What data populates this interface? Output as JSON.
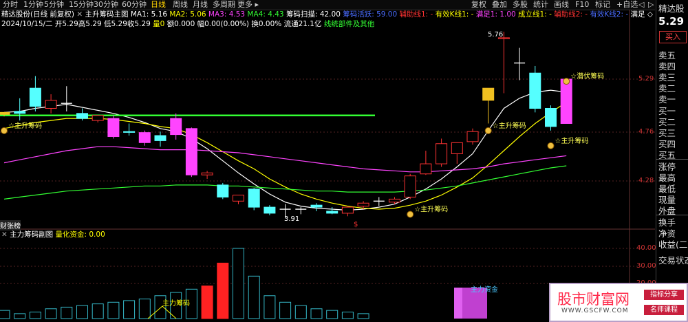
{
  "window": {
    "app_title": "精达股份(日线 前复权)"
  },
  "toolbar": {
    "left_items": [
      "分时",
      "1分钟",
      "5分钟",
      "15分钟",
      "30分钟",
      "60分钟",
      "日线",
      "周线",
      "月线",
      "多周期",
      "更多 ▸"
    ],
    "active": "日线",
    "right_items": [
      "复权",
      "叠加",
      "多股",
      "统计",
      "画线",
      "F10",
      "标记",
      "+自选",
      "◁",
      "▷"
    ]
  },
  "info_row1": {
    "app_title": "精达股份(日线 前复权)",
    "indicator_name": "主升筹码主图",
    "ma": [
      {
        "label": "MA1: 5.16",
        "color": "#ffffff"
      },
      {
        "label": "MA2: 5.06",
        "color": "#ffff00"
      },
      {
        "label": "MA3: 4.53",
        "color": "#ff44ff"
      },
      {
        "label": "MA4: 4.43",
        "color": "#33ff33"
      }
    ],
    "chip_scan": "筹码扫描: 42.00",
    "items": [
      {
        "label": "筹码活跃: 59.00",
        "color": "#4a6cff"
      },
      {
        "label": "辅助线1: -",
        "color": "#ff3333"
      },
      {
        "label": "有效K线1: -",
        "color": "#ffff00"
      },
      {
        "label": "满足1: 1.00",
        "color": "#ff44ff"
      },
      {
        "label": "成立线1: -",
        "color": "#ffff00"
      },
      {
        "label": "辅助线2: -",
        "color": "#ff3333"
      },
      {
        "label": "有效K线2: -",
        "color": "#4a6cff"
      },
      {
        "label": "满足 ◇",
        "color": "#ffffff"
      }
    ]
  },
  "info_row2": {
    "date": "2024/10/15/二",
    "open": "开5.29",
    "high": "高5.29",
    "low": "低5.29",
    "close": "收5.29",
    "volume": "量0",
    "amount": "额0.000",
    "change": "幅0.00(0.00%)",
    "turnover": "换0.00%",
    "float": "流通21.1亿",
    "extra": "线统部件及其他"
  },
  "price_axis": {
    "labels": [
      "5.29",
      "4.76",
      "4.28"
    ]
  },
  "sub_chart": {
    "title": "主力筹码副图",
    "value_label": "量化资金: 0.00",
    "axis_labels": [
      "40.00",
      "30.00",
      "20.00"
    ],
    "chip_label": "主力筹码",
    "fund_label": "主力资金"
  },
  "chart_data": {
    "type": "candlestick",
    "high_annotation": "5.76",
    "low_annotation": "3.91",
    "tag_label": "财张榜",
    "marker_labels": {
      "main_rise": "主升筹码",
      "latent": "潜伏筹码"
    },
    "candles": [
      {
        "o": 4.94,
        "h": 4.96,
        "l": 4.92,
        "c": 4.96,
        "type": "yellow"
      },
      {
        "o": 4.97,
        "h": 5.1,
        "l": 4.88,
        "c": 4.95,
        "type": "cyan"
      },
      {
        "o": 5.02,
        "h": 5.32,
        "l": 4.97,
        "c": 5.2,
        "type": "cyan"
      },
      {
        "o": 5.08,
        "h": 5.14,
        "l": 4.95,
        "c": 5.0,
        "type": "hollow"
      },
      {
        "o": 5.05,
        "h": 5.22,
        "l": 4.97,
        "c": 5.05,
        "type": "doji"
      },
      {
        "o": 4.95,
        "h": 5.0,
        "l": 4.88,
        "c": 4.9,
        "type": "cyan"
      },
      {
        "o": 4.88,
        "h": 4.93,
        "l": 4.86,
        "c": 4.93,
        "type": "hollow"
      },
      {
        "o": 4.9,
        "h": 4.93,
        "l": 4.7,
        "c": 4.72,
        "type": "magenta"
      },
      {
        "o": 4.77,
        "h": 4.85,
        "l": 4.73,
        "c": 4.77,
        "type": "cyan"
      },
      {
        "o": 4.76,
        "h": 4.78,
        "l": 4.63,
        "c": 4.66,
        "type": "magenta"
      },
      {
        "o": 4.68,
        "h": 4.77,
        "l": 4.62,
        "c": 4.73,
        "type": "cyan"
      },
      {
        "o": 4.74,
        "h": 4.95,
        "l": 4.69,
        "c": 4.9,
        "type": "magenta"
      },
      {
        "o": 4.8,
        "h": 4.81,
        "l": 4.32,
        "c": 4.34,
        "type": "magenta"
      },
      {
        "o": 4.34,
        "h": 4.38,
        "l": 4.3,
        "c": 4.36,
        "type": "hollow"
      },
      {
        "o": 4.24,
        "h": 4.26,
        "l": 4.1,
        "c": 4.12,
        "type": "cyan"
      },
      {
        "o": 4.08,
        "h": 4.14,
        "l": 4.05,
        "c": 4.14,
        "type": "hollow"
      },
      {
        "o": 4.2,
        "h": 4.21,
        "l": 3.99,
        "c": 4.02,
        "type": "cyan"
      },
      {
        "o": 4.02,
        "h": 4.04,
        "l": 3.94,
        "c": 3.96,
        "type": "cyan"
      },
      {
        "o": 4.0,
        "h": 4.05,
        "l": 3.91,
        "c": 4.0,
        "type": "doji"
      },
      {
        "o": 4.0,
        "h": 4.02,
        "l": 3.95,
        "c": 4.0,
        "type": "doji"
      },
      {
        "o": 4.02,
        "h": 4.06,
        "l": 3.98,
        "c": 4.04,
        "type": "cyan"
      },
      {
        "o": 3.96,
        "h": 4.02,
        "l": 3.95,
        "c": 3.98,
        "type": "cyan"
      },
      {
        "o": 3.96,
        "h": 4.03,
        "l": 3.93,
        "c": 4.02,
        "type": "hollow"
      },
      {
        "o": 4.03,
        "h": 4.08,
        "l": 4.0,
        "c": 4.06,
        "type": "hollow"
      },
      {
        "o": 4.08,
        "h": 4.12,
        "l": 4.03,
        "c": 4.08,
        "type": "doji"
      },
      {
        "o": 4.07,
        "h": 4.12,
        "l": 4.05,
        "c": 4.1,
        "type": "hollow"
      },
      {
        "o": 4.12,
        "h": 4.35,
        "l": 4.1,
        "c": 4.33,
        "type": "hollow"
      },
      {
        "o": 4.35,
        "h": 4.58,
        "l": 4.34,
        "c": 4.45,
        "type": "hollow"
      },
      {
        "o": 4.45,
        "h": 4.7,
        "l": 4.42,
        "c": 4.65,
        "type": "hollow"
      },
      {
        "o": 4.55,
        "h": 4.66,
        "l": 4.45,
        "c": 4.66,
        "type": "hollow"
      },
      {
        "o": 4.67,
        "h": 4.8,
        "l": 4.64,
        "c": 4.77,
        "type": "hollow"
      },
      {
        "o": 5.08,
        "h": 5.2,
        "l": 4.85,
        "c": 5.2,
        "type": "yellow"
      },
      {
        "o": 5.7,
        "h": 5.76,
        "l": 5.15,
        "c": 5.7,
        "type": "hollow"
      },
      {
        "o": 5.45,
        "h": 5.6,
        "l": 5.28,
        "c": 5.45,
        "type": "doji"
      },
      {
        "o": 5.35,
        "h": 5.42,
        "l": 4.96,
        "c": 5.0,
        "type": "cyan"
      },
      {
        "o": 5.0,
        "h": 5.03,
        "l": 4.78,
        "c": 4.82,
        "type": "cyan"
      },
      {
        "o": 4.85,
        "h": 5.29,
        "l": 4.85,
        "c": 5.29,
        "type": "magenta"
      }
    ],
    "ma_lines": [
      {
        "name": "MA1",
        "color": "#ffffff",
        "values": [
          4.96,
          4.97,
          5.0,
          5.02,
          5.04,
          5.01,
          4.98,
          4.95,
          4.91,
          4.86,
          4.8,
          4.77,
          4.7,
          4.6,
          4.48,
          4.36,
          4.25,
          4.15,
          4.07,
          4.03,
          4.01,
          4.0,
          3.99,
          4.0,
          4.02,
          4.05,
          4.12,
          4.2,
          4.3,
          4.42,
          4.55,
          4.78,
          5.0,
          5.1,
          5.16,
          5.18,
          5.16
        ]
      },
      {
        "name": "MA2",
        "color": "#ffff00",
        "values": [
          4.8,
          4.83,
          4.86,
          4.88,
          4.9,
          4.9,
          4.9,
          4.89,
          4.87,
          4.85,
          4.82,
          4.8,
          4.74,
          4.66,
          4.57,
          4.48,
          4.4,
          4.3,
          4.22,
          4.15,
          4.1,
          4.06,
          4.03,
          4.01,
          4.0,
          4.01,
          4.04,
          4.08,
          4.14,
          4.22,
          4.31,
          4.44,
          4.58,
          4.72,
          4.85,
          4.96,
          5.06
        ]
      },
      {
        "name": "MA3",
        "color": "#ff44ff",
        "values": [
          4.46,
          4.49,
          4.52,
          4.55,
          4.58,
          4.6,
          4.62,
          4.62,
          4.61,
          4.6,
          4.59,
          4.59,
          4.59,
          4.58,
          4.57,
          4.56,
          4.54,
          4.52,
          4.5,
          4.48,
          4.46,
          4.44,
          4.42,
          4.4,
          4.39,
          4.38,
          4.37,
          4.37,
          4.38,
          4.39,
          4.4,
          4.42,
          4.45,
          4.47,
          4.49,
          4.51,
          4.53
        ]
      },
      {
        "name": "MA4",
        "color": "#33ff33",
        "values": [
          4.1,
          4.12,
          4.14,
          4.16,
          4.18,
          4.19,
          4.2,
          4.21,
          4.22,
          4.23,
          4.23,
          4.24,
          4.24,
          4.24,
          4.23,
          4.23,
          4.22,
          4.21,
          4.2,
          4.19,
          4.18,
          4.18,
          4.17,
          4.17,
          4.17,
          4.17,
          4.18,
          4.19,
          4.21,
          4.23,
          4.26,
          4.29,
          4.32,
          4.35,
          4.38,
          4.41,
          4.43
        ]
      }
    ],
    "support_line": {
      "value": 4.93,
      "color": "#33ff33"
    },
    "volume_bars": [
      {
        "v": 5,
        "c": "#35b8c8"
      },
      {
        "v": 3,
        "c": "#35b8c8"
      },
      {
        "v": 4,
        "c": "#35b8c8"
      },
      {
        "v": 6,
        "c": "#35b8c8"
      },
      {
        "v": 7,
        "c": "#35b8c8"
      },
      {
        "v": 8,
        "c": "#35b8c8"
      },
      {
        "v": 9,
        "c": "#35b8c8"
      },
      {
        "v": 10,
        "c": "#35b8c8"
      },
      {
        "v": 11,
        "c": "#35b8c8"
      },
      {
        "v": 12,
        "c": "#35b8c8"
      },
      {
        "v": 14,
        "c": "#35b8c8"
      },
      {
        "v": 16,
        "c": "#35b8c8"
      },
      {
        "v": 18,
        "c": "#35b8c8"
      },
      {
        "v": 20,
        "c": "#ff2222"
      },
      {
        "v": 34,
        "c": "#ff2222"
      },
      {
        "v": 43,
        "c": "#35b8c8"
      },
      {
        "v": 26,
        "c": "#35b8c8"
      },
      {
        "v": 14,
        "c": "#35b8c8"
      },
      {
        "v": 10,
        "c": "#35b8c8"
      },
      {
        "v": 8,
        "c": "#35b8c8"
      },
      {
        "v": 6,
        "c": "#35b8c8"
      },
      {
        "v": 5,
        "c": "#35b8c8"
      },
      {
        "v": 4,
        "c": "#35b8c8"
      },
      {
        "v": 3,
        "c": "#35b8c8"
      }
    ]
  },
  "right_panel": {
    "name": "精达股",
    "price": "5.29",
    "buy_button": "买入",
    "rows": [
      "卖五",
      "卖四",
      "卖三",
      "卖二",
      "卖一",
      "买一",
      "买二",
      "买三",
      "买四",
      "买五",
      "涨停",
      "最高",
      "最低",
      "现量",
      "外盘",
      "换手",
      "净资",
      "收益(二)",
      "交易状态"
    ]
  },
  "watermark": {
    "title": "股市财富网",
    "url": "WWW.GSCFW.COM",
    "tag1": "指标分享",
    "tag2": "名师课程"
  }
}
